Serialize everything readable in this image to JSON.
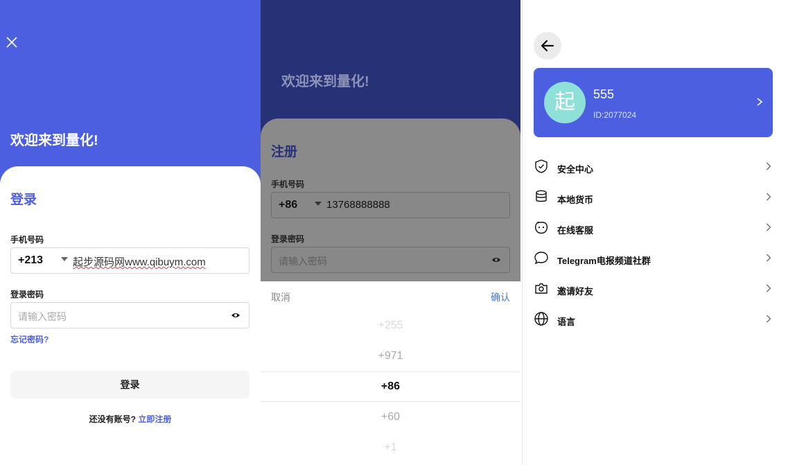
{
  "colors": {
    "primary": "#4b5fe0",
    "dark_header": "#273175",
    "link": "#4b79d6"
  },
  "login": {
    "close_icon": "close-icon",
    "welcome": "欢迎来到量化!",
    "title": "登录",
    "phone_label": "手机号码",
    "country_code": "+213",
    "phone_value": "起步源码网www.qibuym.com",
    "password_label": "登录密码",
    "password_placeholder": "请输入密码",
    "forgot": "忘记密码?",
    "login_button": "登录",
    "no_account": "还没有账号?",
    "register_link": "立即注册"
  },
  "register": {
    "welcome": "欢迎来到量化!",
    "title": "注册",
    "phone_label": "手机号码",
    "country_code": "+86",
    "phone_value": "13768888888",
    "password_label": "登录密码",
    "password_placeholder": "请输入密码",
    "picker": {
      "cancel": "取消",
      "confirm": "确认",
      "options": [
        "+255",
        "+971",
        "+86",
        "+60",
        "+1"
      ],
      "selected": "+86"
    }
  },
  "profile": {
    "back_icon": "back-arrow-icon",
    "avatar_char": "起",
    "username": "555",
    "user_id": "ID:2077024",
    "menu": [
      {
        "label": "安全中心",
        "icon": "shield-icon"
      },
      {
        "label": "本地货币",
        "icon": "coins-icon"
      },
      {
        "label": "在线客服",
        "icon": "service-icon"
      },
      {
        "label": "Telegram电报频道社群",
        "icon": "chat-icon"
      },
      {
        "label": "邀请好友",
        "icon": "invite-icon"
      },
      {
        "label": "语言",
        "icon": "globe-icon"
      }
    ]
  }
}
